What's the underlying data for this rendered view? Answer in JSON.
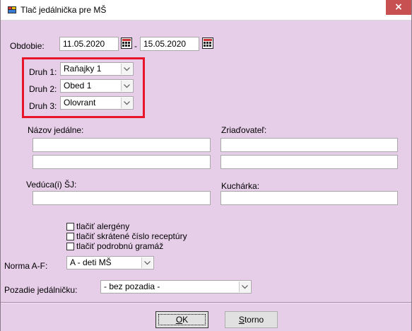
{
  "window": {
    "title": "Tlač jedálnička pre MŠ",
    "close_symbol": "×"
  },
  "period": {
    "label": "Obdobie:",
    "from": "11.05.2020",
    "separator": "-",
    "to": "15.05.2020"
  },
  "kinds": [
    {
      "label": "Druh 1:",
      "value": "Raňajky 1"
    },
    {
      "label": "Druh 2:",
      "value": "Obed 1"
    },
    {
      "label": "Druh 3:",
      "value": "Olovrant"
    }
  ],
  "canteen": {
    "label": "Názov jedálne:",
    "line1": "",
    "line2": ""
  },
  "founder": {
    "label": "Zriaďovateľ:",
    "line1": "",
    "line2": ""
  },
  "manager": {
    "label": "Vedúca(i) ŠJ:",
    "value": ""
  },
  "cook": {
    "label": "Kuchárka:",
    "value": ""
  },
  "options": [
    {
      "label": "tlačiť alergény",
      "checked": false
    },
    {
      "label": "tlačiť skrátené číslo receptúry",
      "checked": false
    },
    {
      "label": "tlačiť podrobnú gramáž",
      "checked": false
    }
  ],
  "norm": {
    "label": "Norma A-F:",
    "value": "A - deti MŠ"
  },
  "background": {
    "label": "Pozadie jedálničku:",
    "value": "- bez pozadia -"
  },
  "buttons": {
    "ok_mnemonic": "O",
    "ok_rest": "K",
    "cancel_mnemonic": "S",
    "cancel_rest": "torno"
  },
  "colors": {
    "window_bg": "#e6cde8",
    "highlight_border": "#e8152a",
    "close_bg": "#c75050"
  }
}
